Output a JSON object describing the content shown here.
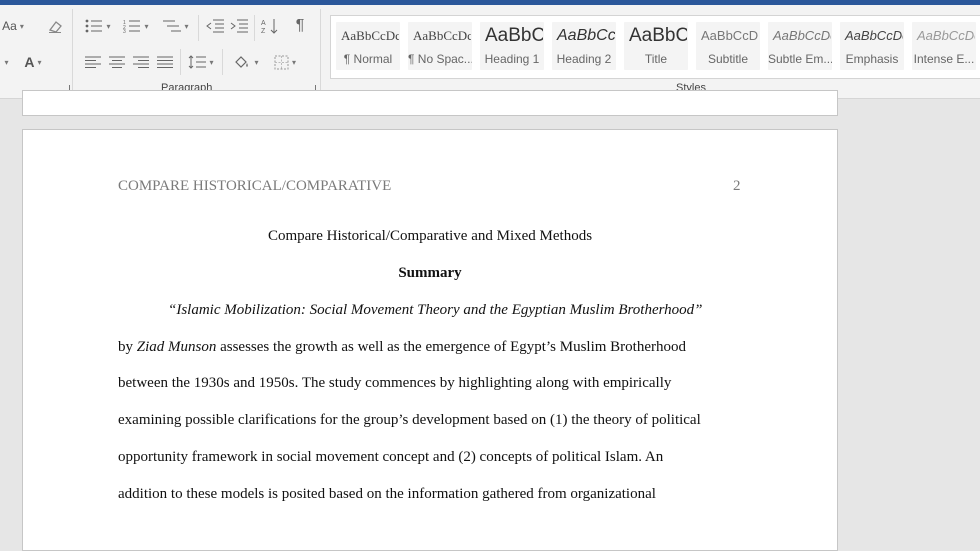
{
  "ribbon": {
    "font_size_label": "Aa",
    "font_color_label": "A",
    "group_paragraph": "Paragraph",
    "group_styles": "Styles",
    "styles": [
      {
        "preview": "AaBbCcDc",
        "name": "¶ Normal"
      },
      {
        "preview": "AaBbCcDc",
        "name": "¶ No Spac..."
      },
      {
        "preview": "AaBbC",
        "name": "Heading 1"
      },
      {
        "preview": "AaBbCc",
        "name": "Heading 2"
      },
      {
        "preview": "AaBbC",
        "name": "Title"
      },
      {
        "preview": "AaBbCcD",
        "name": "Subtitle"
      },
      {
        "preview": "AaBbCcDc",
        "name": "Subtle Em..."
      },
      {
        "preview": "AaBbCcDc",
        "name": "Emphasis"
      },
      {
        "preview": "AaBbCcDc",
        "name": "Intense E..."
      }
    ],
    "colors": {
      "accent": "#2b579a"
    }
  },
  "document": {
    "header_text": "COMPARE HISTORICAL/COMPARATIVE",
    "page_number": "2",
    "title": "Compare Historical/Comparative and Mixed Methods",
    "heading": "Summary",
    "line1_italic": "“Islamic Mobilization: Social Movement Theory and the Egyptian Muslim Brotherhood”",
    "line2_prefix": "by ",
    "line2_author": "Ziad Munson",
    "line2_rest": " assesses the growth as well as the emergence of Egypt’s Muslim Brotherhood",
    "line3": "between the 1930s and 1950s. The study commences by highlighting along with empirically",
    "line4": "examining possible clarifications for the group’s development based on (1) the theory of political",
    "line5": "opportunity framework in social movement concept and (2) concepts of political Islam. An",
    "line6": "addition to these models is posited based on the information gathered from organizational"
  }
}
